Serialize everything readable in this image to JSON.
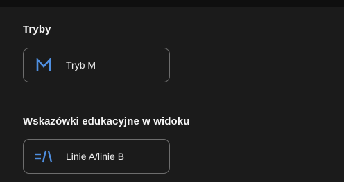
{
  "sections": {
    "modes": {
      "title": "Tryby",
      "option": {
        "label": "Tryb M",
        "icon": "m-letter-icon"
      }
    },
    "education": {
      "title": "Wskazówki edukacyjne w widoku",
      "option": {
        "label": "Linie A/linie B",
        "icon": "ab-lines-icon"
      }
    }
  },
  "colors": {
    "background": "#1b1b1b",
    "accent": "#4f8fe0",
    "border": "#6d6d6d",
    "text": "#f2f2f2"
  }
}
